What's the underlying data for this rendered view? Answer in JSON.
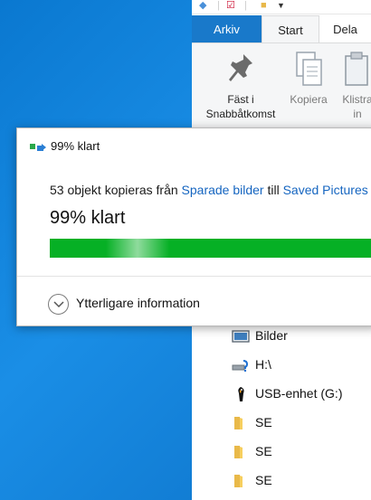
{
  "ribbon": {
    "tabs": [
      "Arkiv",
      "Start",
      "Dela"
    ],
    "buttons": {
      "pin": [
        "Fäst i",
        "Snabbåtkomst"
      ],
      "copy": "Kopiera",
      "paste": [
        "Klistra",
        "in"
      ]
    }
  },
  "nav": {
    "items": [
      {
        "label": "Bilder",
        "icon": "pictures-icon"
      },
      {
        "label": "H:\\",
        "icon": "drive-icon"
      },
      {
        "label": "USB-enhet (G:)",
        "icon": "usb-drive-icon"
      },
      {
        "label": "SE",
        "icon": "folder-icon"
      },
      {
        "label": "SE",
        "icon": "folder-icon"
      },
      {
        "label": "SE",
        "icon": "folder-icon"
      }
    ]
  },
  "dialog": {
    "title": "99% klart",
    "desc_prefix": "53 objekt kopieras från ",
    "source": "Sparade bilder",
    "desc_mid": " till ",
    "destination": "Saved Pictures",
    "percent_text": "99% klart",
    "progress": 0.99,
    "more_info": "Ytterligare information"
  },
  "colors": {
    "accent": "#1979ca",
    "progress": "#06b025",
    "link": "#1565c0",
    "desktop": "#0a78d0"
  }
}
